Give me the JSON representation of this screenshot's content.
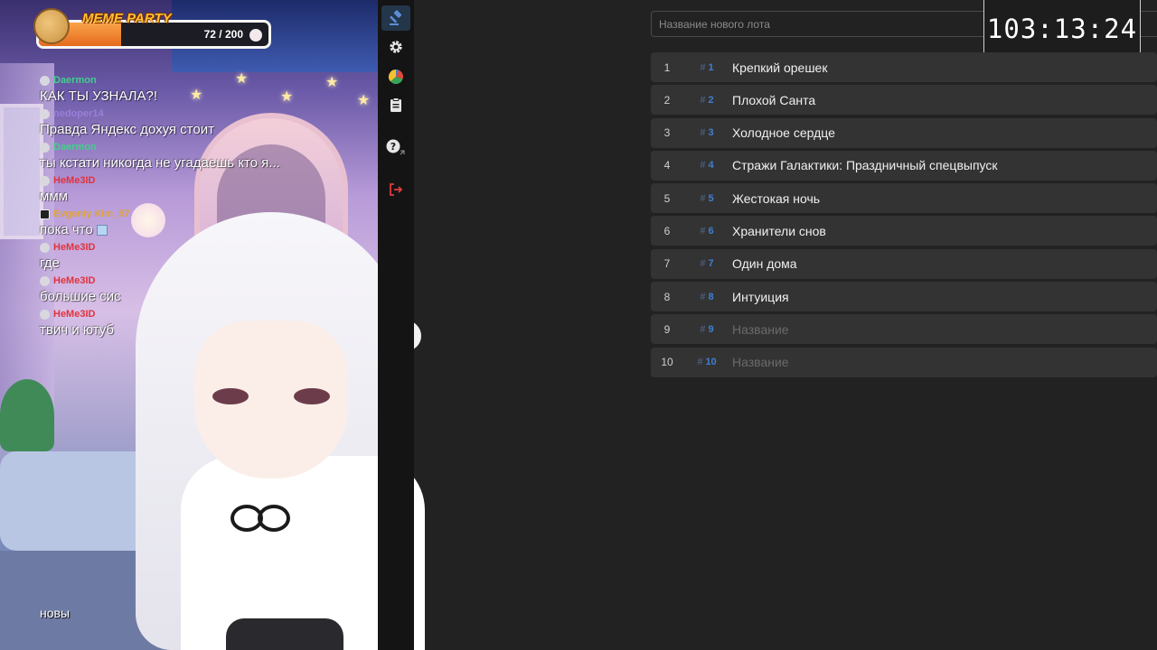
{
  "widget": {
    "title": "MEME PARTY",
    "current": 72,
    "goal": 200,
    "count_text": "72 / 200"
  },
  "chat": [
    {
      "user": "Daermon",
      "color": "#3fd18a",
      "text": "КАК ТЫ УЗНАЛА?!",
      "badge": "circle"
    },
    {
      "user": "nedoper14",
      "color": "#9a7fd8",
      "text": "Правда Яндекс дохуя стоит",
      "badge": "circle"
    },
    {
      "user": "Daermon",
      "color": "#3fd18a",
      "text": "ты кстати никогда не угадаешь кто я...",
      "badge": "circle"
    },
    {
      "user": "HeMe3ID",
      "color": "#e0333d",
      "text": "ммм",
      "badge": "circle"
    },
    {
      "user": "Evgeniy Kim_57",
      "color": "#e0a23a",
      "text": "пока что",
      "badge": "play",
      "has_image": true
    },
    {
      "user": "HeMe3ID",
      "color": "#e0333d",
      "text": "где",
      "badge": "circle"
    },
    {
      "user": "HeMe3ID",
      "color": "#e0333d",
      "text": "большие сис",
      "badge": "circle"
    },
    {
      "user": "HeMe3ID",
      "color": "#e0333d",
      "text": "твич и ютуб",
      "badge": "circle"
    }
  ],
  "chat_tail": "новы",
  "sidebar": {
    "items": [
      {
        "icon": "gavel-icon",
        "active": true
      },
      {
        "icon": "gear-icon",
        "active": false
      },
      {
        "icon": "pie-chart-icon",
        "active": false
      },
      {
        "icon": "clipboard-icon",
        "active": false
      },
      {
        "icon": "help-icon",
        "active": false
      },
      {
        "icon": "logout-icon",
        "active": false
      }
    ]
  },
  "auction": {
    "new_lot_placeholder": "Название нового лота",
    "new_lot_value": "",
    "timer": "103:13:24",
    "lot_placeholder": "Название",
    "lots": [
      {
        "index": "1",
        "fast_id": "1",
        "title": "Крепкий орешек"
      },
      {
        "index": "2",
        "fast_id": "2",
        "title": "Плохой Санта"
      },
      {
        "index": "3",
        "fast_id": "3",
        "title": "Холодное сердце"
      },
      {
        "index": "4",
        "fast_id": "4",
        "title": "Стражи Галактики: Праздничный спецвыпуск"
      },
      {
        "index": "5",
        "fast_id": "5",
        "title": "Жестокая ночь"
      },
      {
        "index": "6",
        "fast_id": "6",
        "title": "Хранители снов"
      },
      {
        "index": "7",
        "fast_id": "7",
        "title": "Один дома"
      },
      {
        "index": "8",
        "fast_id": "8",
        "title": "Интуиция"
      },
      {
        "index": "9",
        "fast_id": "9",
        "title": ""
      },
      {
        "index": "10",
        "fast_id": "10",
        "title": ""
      }
    ]
  },
  "colors": {
    "accent": "#3f7fd1",
    "logout": "#e03c3c",
    "timer_border": "#cfcfcf"
  }
}
